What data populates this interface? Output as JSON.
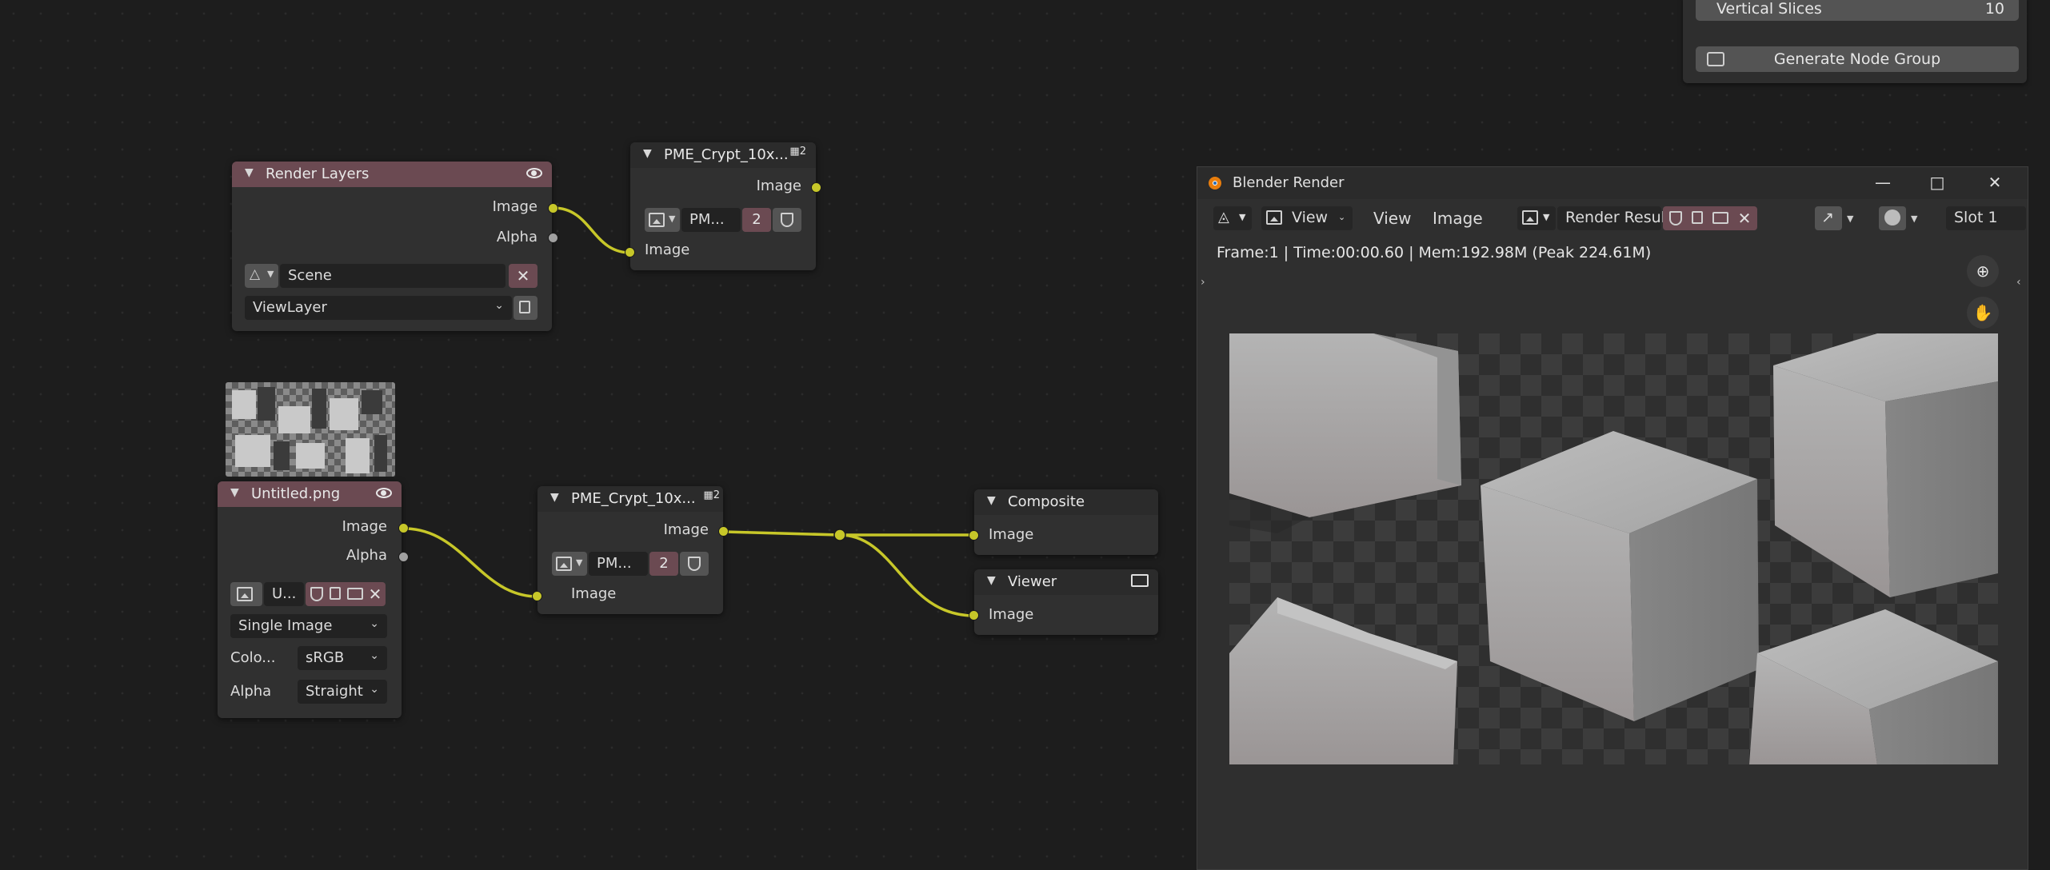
{
  "properties_panel": {
    "vertical_slices_label": "Vertical Slices",
    "vertical_slices_value": "10",
    "generate_button": "Generate Node Group"
  },
  "nodes": {
    "render_layers": {
      "title": "Render Layers",
      "outputs": [
        "Image",
        "Alpha"
      ],
      "scene": "Scene",
      "view_layer": "ViewLayer"
    },
    "crypt_group_top": {
      "title": "PME_Crypt_10x...",
      "user_count": "2",
      "output": "Image",
      "datablock": "PM...",
      "datablock_users": "2",
      "input": "Image"
    },
    "image_node": {
      "title": "Untitled.png",
      "outputs": [
        "Image",
        "Alpha"
      ],
      "datablock": "U...",
      "source": "Single Image",
      "color_label": "Colo...",
      "color_value": "sRGB",
      "alpha_label": "Alpha",
      "alpha_value": "Straight"
    },
    "crypt_group_bottom": {
      "title": "PME_Crypt_10x...",
      "user_count": "2",
      "output": "Image",
      "datablock": "PM...",
      "datablock_users": "2",
      "input": "Image"
    },
    "composite": {
      "title": "Composite",
      "input": "Image"
    },
    "viewer": {
      "title": "Viewer",
      "input": "Image"
    }
  },
  "render_window": {
    "title": "Blender Render",
    "menu_view": "View",
    "menu_view2": "View",
    "menu_image": "Image",
    "image_name": "Render Result",
    "slot": "Slot 1",
    "info": "Frame:1 | Time:00:00.60 | Mem:192.98M (Peak 224.61M)"
  },
  "colors": {
    "socket_image": "#c7c729",
    "socket_alpha": "#a1a1a1",
    "input_header": "#6b4a52",
    "wire": "#c7c729"
  }
}
